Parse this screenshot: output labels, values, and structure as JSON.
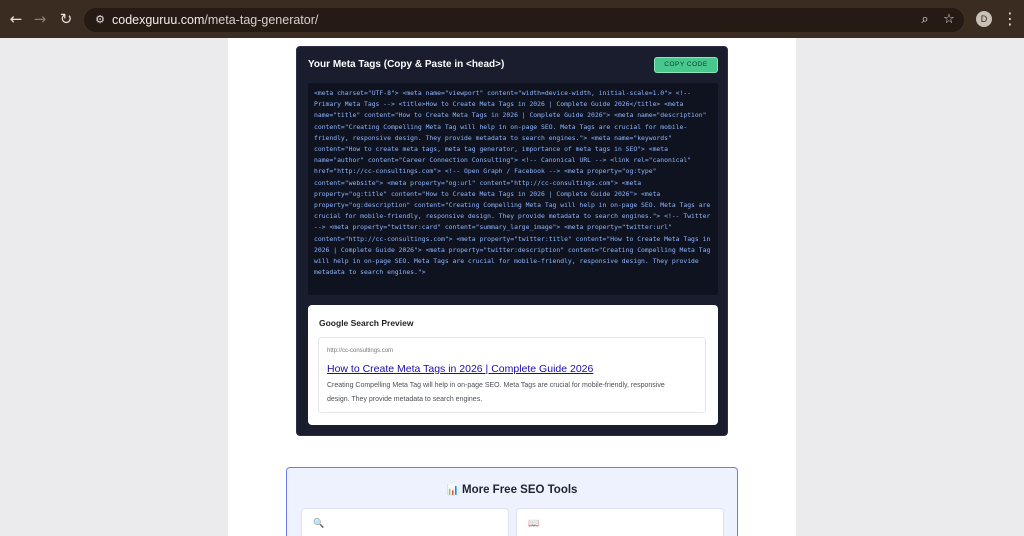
{
  "browser": {
    "back_icon": "arrow-left-icon",
    "forward_icon": "arrow-right-icon",
    "reload_icon": "reload-icon",
    "url_domain": "codexguruu.com",
    "url_path": "/meta-tag-generator/",
    "avatar_initial": "D"
  },
  "meta_card": {
    "title": "Your Meta Tags (Copy & Paste in <head>)",
    "copy_button": "COPY CODE",
    "code": "<meta charset=\"UTF-8\"> <meta name=\"viewport\" content=\"width=device-width, initial-scale=1.0\"> <!-- Primary Meta Tags --> <title>How to Create Meta Tags in 2026 | Complete Guide 2026</title> <meta name=\"title\" content=\"How to Create Meta Tags in 2026 | Complete Guide 2026\"> <meta name=\"description\" content=\"Creating Compelling Meta Tag will help in on-page SEO. Meta Tags are crucial for mobile-friendly, responsive design. They provide metadata to search engines.\"> <meta name=\"keywords\" content=\"How to create meta tags, meta tag generator, importance of meta tags in SEO\"> <meta name=\"author\" content=\"Career Connection Consulting\"> <!-- Canonical URL --> <link rel=\"canonical\" href=\"http://cc-consultings.com\"> <!-- Open Graph / Facebook --> <meta property=\"og:type\" content=\"website\"> <meta property=\"og:url\" content=\"http://cc-consultings.com\"> <meta property=\"og:title\" content=\"How to Create Meta Tags in 2026 | Complete Guide 2026\"> <meta property=\"og:description\" content=\"Creating Compelling Meta Tag will help in on-page SEO. Meta Tags are crucial for mobile-friendly, responsive design. They provide metadata to search engines.\"> <!-- Twitter --> <meta property=\"twitter:card\" content=\"summary_large_image\"> <meta property=\"twitter:url\" content=\"http://cc-consultings.com\"> <meta property=\"twitter:title\" content=\"How to Create Meta Tags in 2026 | Complete Guide 2026\"> <meta property=\"twitter:description\" content=\"Creating Compelling Meta Tag will help in on-page SEO. Meta Tags are crucial for mobile-friendly, responsive design. They provide metadata to search engines.\">"
  },
  "preview": {
    "title": "Google Search Preview",
    "url": "http://cc-consultings.com",
    "result_title": "How to Create Meta Tags in 2026 | Complete Guide 2026",
    "result_desc": "Creating Compelling Meta Tag will help in on-page SEO. Meta Tags are crucial for mobile-friendly, responsive design. They provide metadata to search engines."
  },
  "tools": {
    "icon": "📊",
    "title": "More Free SEO Tools",
    "tile1_icon": "🔍",
    "tile2_icon": "📖"
  },
  "colors": {
    "accent_green": "#48c78e",
    "dark_bg": "#1a1d2e",
    "link_blue": "#1a0dab"
  }
}
